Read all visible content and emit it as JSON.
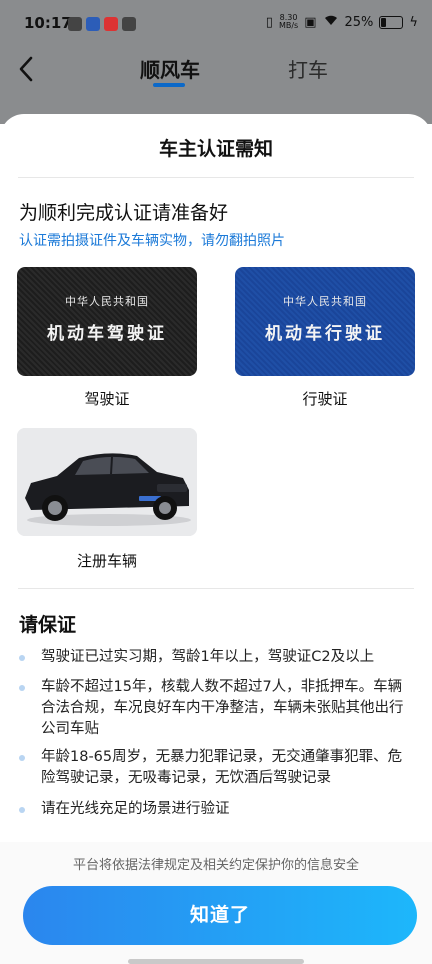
{
  "status_bar": {
    "time": "10:17",
    "net_speed": "8.30",
    "net_unit": "MB/s",
    "battery": "25%",
    "icons": [
      "vibrate-icon",
      "nfc-icon",
      "wifi-icon",
      "battery-icon",
      "charging-icon"
    ]
  },
  "nav": {
    "back_label": "‹",
    "tab_active": "顺风车",
    "tab_other": "打车"
  },
  "sheet": {
    "title": "车主认证需知",
    "prep_heading": "为顺利完成认证请准备好",
    "prep_sub": "认证需拍摄证件及车辆实物，请勿翻拍照片",
    "cards": [
      {
        "top": "中华人民共和国",
        "main": "机动车驾驶证",
        "label": "驾驶证"
      },
      {
        "top": "中华人民共和国",
        "main": "机动车行驶证",
        "label": "行驶证"
      }
    ],
    "car_label": "注册车辆",
    "assure_heading": "请保证",
    "bullets": [
      "驾驶证已过实习期，驾龄1年以上，驾驶证C2及以上",
      "车龄不超过15年，核载人数不超过7人，非抵押车。车辆合法合规，车况良好车内干净整洁，车辆未张贴其他出行公司车贴",
      "年龄18-65周岁，无暴力犯罪记录，无交通肇事犯罪、危险驾驶记录，无吸毒记录，无饮酒后驾驶记录",
      "请在光线充足的场景进行验证"
    ],
    "privacy": "平台将依据法律规定及相关约定保护你的信息安全",
    "ok_button": "知道了"
  },
  "colors": {
    "accent": "#1c7ad8",
    "button_start": "#2b86ee",
    "button_end": "#1db7fb",
    "license_bg": "#1f1f1f",
    "vehicle_license_bg": "#1f4fa6"
  }
}
